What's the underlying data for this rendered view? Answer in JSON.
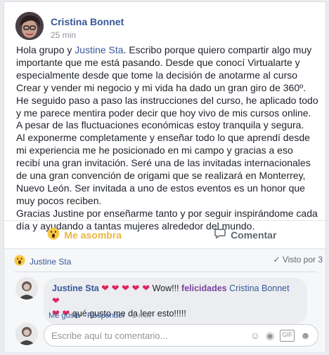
{
  "post": {
    "author": "Cristina Bonnet",
    "time": "25 min",
    "p1_a": "Hola grupo y ",
    "p1_mention": "Justine Sta",
    "p1_b": ". Escribo porque quiero compartir algo muy importante que me está pasando. Desde que conocí Virtualarte y especialmente desde que tome la decisión de anotarme al curso Crear y vender mi negocio y mi vida ha dado un gran giro de 360º.",
    "p2": "He seguido paso a paso las instrucciones del curso, he aplicado todo y me parece mentira poder decir que hoy vivo de mis cursos online. A pesar de las fluctuaciones económicas estoy tranquila y segura.",
    "p3": "Al exponerme completamente y enseñar todo lo que aprendí desde mi experiencia me he posicionado en mi campo y gracias a eso recibí una gran invitación. Seré una de las invitadas internacionales de una gran convención de origami que se realizará en Monterrey, Nuevo León. Ser invitada a uno de estos eventos es un honor que muy pocos reciben.",
    "p4": "Gracias Justine por enseñarme tanto y por seguir inspirándome cada día y ayudando a tantas mujeres alrededor del mundo."
  },
  "actions": {
    "reaction_label": "Me asombra",
    "comment_label": "Comentar"
  },
  "reactions": {
    "reactor": "Justine Sta",
    "seen_label": "Visto por 3"
  },
  "comment": {
    "author": "Justine Sta",
    "text_a": "Wow!!! ",
    "text_fel": "felicidades",
    "mention": "Cristina Bonnet",
    "text_b": "qué gusto me da leer esto!!!!!",
    "like": "Me gusta",
    "reply": "Responder",
    "time": "1 min"
  },
  "composer": {
    "placeholder": "Escribe aquí tu comentario...",
    "icons": [
      "smiley-icon",
      "camera-icon",
      "gif-icon",
      "sticker-icon"
    ]
  }
}
